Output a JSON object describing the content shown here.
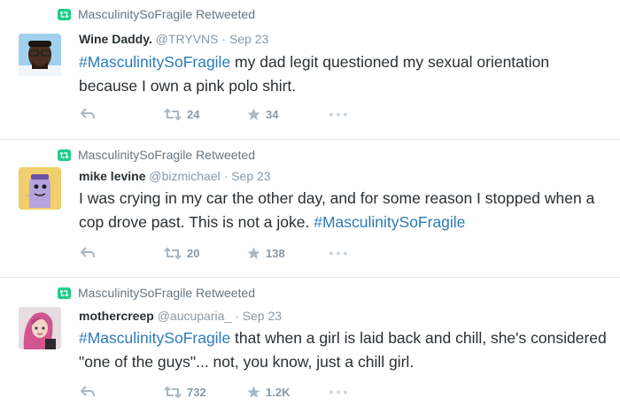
{
  "tweets": [
    {
      "retweeted_by": "MasculinitySoFragile Retweeted",
      "name": "Wine Daddy.",
      "handle": "@TRYVNS",
      "date": "Sep 23",
      "hashtag": "#MasculinitySoFragile",
      "text_after": " my dad legit questioned my sexual orientation because I own a pink polo shirt.",
      "text_before": "",
      "retweets": "24",
      "favorites": "34",
      "avatar_icon": "user-avatar-man-glasses"
    },
    {
      "retweeted_by": "MasculinitySoFragile Retweeted",
      "name": "mike levine",
      "handle": "@bizmichael",
      "date": "Sep 23",
      "hashtag": "#MasculinitySoFragile",
      "text_before": "I was crying in my car the other day, and for some reason I stopped when a cop drove past. This is not a joke. ",
      "text_after": "",
      "retweets": "20",
      "favorites": "138",
      "avatar_icon": "user-avatar-cartoon"
    },
    {
      "retweeted_by": "MasculinitySoFragile Retweeted",
      "name": "mothercreep",
      "handle": "@aucuparia_",
      "date": "Sep 23",
      "hashtag": "#MasculinitySoFragile",
      "text_before": "",
      "text_after": " that when a girl is laid back and chill, she's considered \"one of the guys\"... not, you know, just a chill girl.",
      "retweets": "732",
      "favorites": "1.2K",
      "avatar_icon": "user-avatar-pink-hair"
    }
  ],
  "colors": {
    "hashtag": "#2b7bb9",
    "retweet_badge": "#19cf86",
    "muted": "#8899a6"
  }
}
